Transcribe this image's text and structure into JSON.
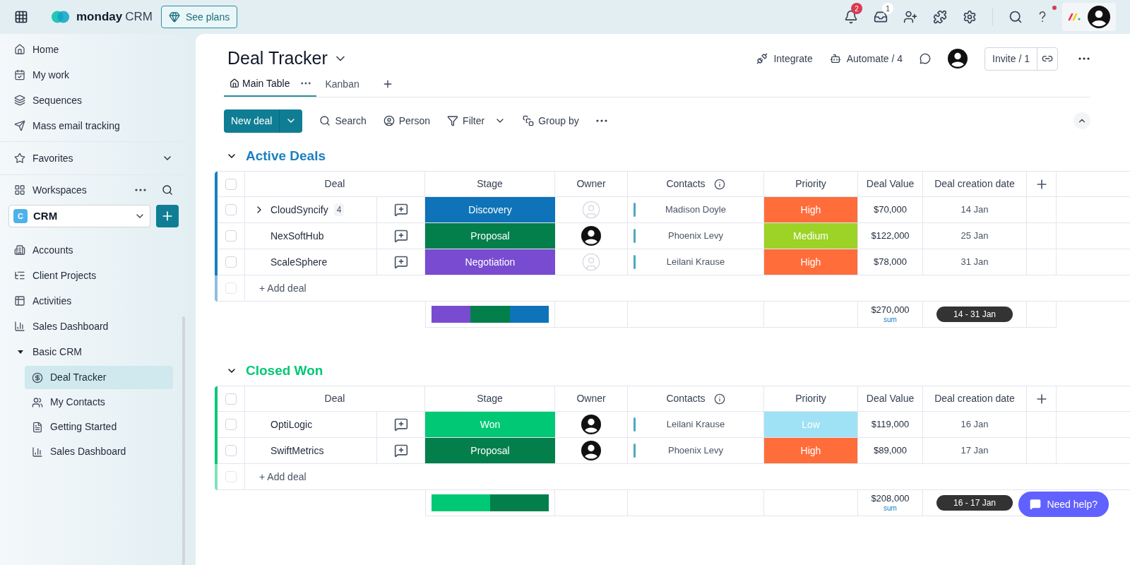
{
  "topbar": {
    "brand": "monday",
    "brand_suffix": "CRM",
    "see_plans": "See plans",
    "notifications_badge": "2",
    "inbox_badge": "1",
    "help_dot": true
  },
  "sidebar": {
    "nav": [
      {
        "label": "Home",
        "kind": "home"
      },
      {
        "label": "My work",
        "kind": "calendar"
      },
      {
        "label": "Sequences",
        "kind": "stack"
      },
      {
        "label": "Mass email tracking",
        "kind": "send"
      }
    ],
    "favorites": {
      "label": "Favorites",
      "expanded": false
    },
    "workspaces": {
      "label": "Workspaces"
    },
    "workspace": {
      "letter": "C",
      "name": "CRM"
    },
    "items": [
      {
        "label": "Accounts",
        "kind": "building"
      },
      {
        "label": "Client Projects",
        "kind": "list"
      },
      {
        "label": "Activities",
        "kind": "table"
      },
      {
        "label": "Sales Dashboard",
        "kind": "chart"
      },
      {
        "label": "Basic CRM",
        "kind": "folder",
        "expanded": true,
        "children": [
          {
            "label": "Deal Tracker",
            "kind": "dollar",
            "selected": true
          },
          {
            "label": "My Contacts",
            "kind": "people",
            "selected": false
          },
          {
            "label": "Getting Started",
            "kind": "doc",
            "selected": false
          },
          {
            "label": "Sales Dashboard",
            "kind": "chart",
            "selected": false
          }
        ]
      }
    ]
  },
  "board": {
    "title": "Deal Tracker",
    "actions": {
      "integrate": "Integrate",
      "automate": "Automate / 4",
      "invite": "Invite / 1"
    },
    "tabs": [
      {
        "label": "Main Table",
        "selected": true
      },
      {
        "label": "Kanban",
        "selected": false
      }
    ],
    "toolbar": {
      "new_item": "New deal",
      "search": "Search",
      "person": "Person",
      "filter": "Filter",
      "group_by": "Group by"
    },
    "groups": [
      {
        "name": "Active Deals",
        "color": "#1a7fc1",
        "expanded": true,
        "all_checked": false,
        "add_row": "+ Add deal",
        "columns": [
          "Deal",
          "Stage",
          "Owner",
          "Contacts",
          "Priority",
          "Deal Value",
          "Deal creation date"
        ],
        "rows": [
          {
            "checked": false,
            "deal": "CloudSyncify",
            "subitems": "4",
            "stage": {
              "label": "Discovery",
              "color": "#0e73b8"
            },
            "owner_assigned": false,
            "contact": "Madison Doyle",
            "priority": {
              "label": "High",
              "color": "#ff6d3b"
            },
            "value": "$70,000",
            "date": "14 Jan"
          },
          {
            "checked": false,
            "deal": "NexSoftHub",
            "stage": {
              "label": "Proposal",
              "color": "#037f4c"
            },
            "owner_assigned": true,
            "contact": "Phoenix Levy",
            "priority": {
              "label": "Medium",
              "color": "#9cd326"
            },
            "value": "$122,000",
            "date": "25 Jan"
          },
          {
            "checked": false,
            "deal": "ScaleSphere",
            "stage": {
              "label": "Negotiation",
              "color": "#784bd1"
            },
            "owner_assigned": false,
            "contact": "Leilani Krause",
            "priority": {
              "label": "High",
              "color": "#ff6d3b"
            },
            "value": "$78,000",
            "date": "31 Jan"
          }
        ],
        "summary": {
          "stage_segments": [
            {
              "color": "#784bd1"
            },
            {
              "color": "#037f4c"
            },
            {
              "color": "#0e73b8"
            }
          ],
          "sum": "$270,000",
          "sum_label": "sum",
          "date_range": "14 - 31 Jan"
        }
      },
      {
        "name": "Closed Won",
        "color": "#00c875",
        "expanded": true,
        "all_checked": false,
        "add_row": "+ Add deal",
        "columns": [
          "Deal",
          "Stage",
          "Owner",
          "Contacts",
          "Priority",
          "Deal Value",
          "Deal creation date"
        ],
        "rows": [
          {
            "checked": false,
            "deal": "OptiLogic",
            "stage": {
              "label": "Won",
              "color": "#00c875"
            },
            "owner_assigned": true,
            "contact": "Leilani Krause",
            "priority": {
              "label": "Low",
              "color": "#9fe1f5"
            },
            "value": "$119,000",
            "date": "16 Jan"
          },
          {
            "checked": false,
            "deal": "SwiftMetrics",
            "stage": {
              "label": "Proposal",
              "color": "#037f4c"
            },
            "owner_assigned": true,
            "contact": "Phoenix Levy",
            "priority": {
              "label": "High",
              "color": "#ff6d3b"
            },
            "value": "$89,000",
            "date": "17 Jan"
          }
        ],
        "summary": {
          "stage_segments": [
            {
              "color": "#00c875"
            },
            {
              "color": "#037f4c"
            }
          ],
          "sum": "$208,000",
          "sum_label": "sum",
          "date_range": "16 - 17 Jan"
        }
      }
    ],
    "help_button": "Need help?"
  }
}
